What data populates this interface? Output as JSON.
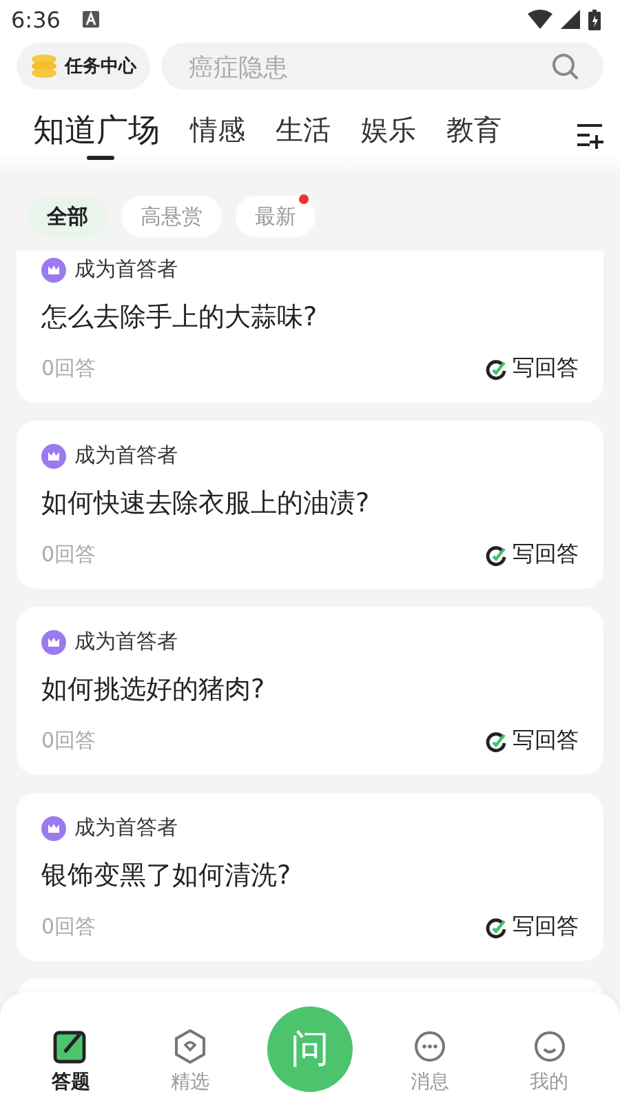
{
  "status_bar": {
    "time": "6:36"
  },
  "header": {
    "task_center": "任务中心",
    "search": {
      "placeholder": "癌症隐患"
    }
  },
  "tabs": [
    {
      "label": "知道广场",
      "selected": true
    },
    {
      "label": "情感",
      "selected": false
    },
    {
      "label": "生活",
      "selected": false
    },
    {
      "label": "娱乐",
      "selected": false
    },
    {
      "label": "教育",
      "selected": false
    }
  ],
  "filters": [
    {
      "label": "全部",
      "selected": true,
      "new_dot": false
    },
    {
      "label": "高悬赏",
      "selected": false,
      "new_dot": false
    },
    {
      "label": "最新",
      "selected": false,
      "new_dot": true
    }
  ],
  "questions": [
    {
      "badge": "成为首答者",
      "title": "怎么去除手上的大蒜味?",
      "answers": "0回答",
      "action": "写回答"
    },
    {
      "badge": "成为首答者",
      "title": "如何快速去除衣服上的油渍?",
      "answers": "0回答",
      "action": "写回答"
    },
    {
      "badge": "成为首答者",
      "title": "如何挑选好的猪肉?",
      "answers": "0回答",
      "action": "写回答"
    },
    {
      "badge": "成为首答者",
      "title": "银饰变黑了如何清洗?",
      "answers": "0回答",
      "action": "写回答"
    }
  ],
  "bottom_nav": [
    {
      "kind": "answer",
      "label": "答题",
      "selected": true
    },
    {
      "kind": "featured",
      "label": "精选",
      "selected": false
    },
    {
      "kind": "ask",
      "label": "问",
      "selected": false
    },
    {
      "kind": "messages",
      "label": "消息",
      "selected": false
    },
    {
      "kind": "me",
      "label": "我的",
      "selected": false
    }
  ]
}
